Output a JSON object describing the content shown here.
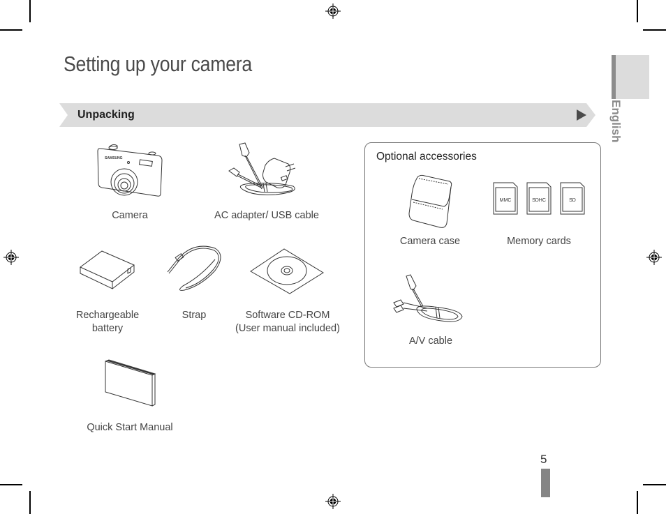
{
  "page": {
    "title": "Setting up your camera",
    "language_tab": "English",
    "page_number": "5"
  },
  "section": {
    "heading": "Unpacking"
  },
  "included_items": [
    {
      "label": "Camera",
      "icon": "camera-icon"
    },
    {
      "label": "AC adapter/ USB cable",
      "icon": "ac-adapter-icon"
    },
    {
      "label_line1": "Rechargeable",
      "label_line2": "battery",
      "icon": "battery-icon"
    },
    {
      "label": "Strap",
      "icon": "strap-icon"
    },
    {
      "label_line1": "Software CD-ROM",
      "label_line2": "(User manual included)",
      "icon": "cd-rom-icon"
    },
    {
      "label": "Quick Start Manual",
      "icon": "manual-icon"
    }
  ],
  "optional_accessories": {
    "title": "Optional accessories",
    "items": [
      {
        "label": "Camera case",
        "icon": "camera-case-icon"
      },
      {
        "label": "Memory cards",
        "icon": "memory-card-icon",
        "cards": [
          "MMC",
          "SDHC",
          "SD"
        ]
      },
      {
        "label": "A/V cable",
        "icon": "av-cable-icon"
      }
    ]
  },
  "colors": {
    "banner": "#dcdcdc",
    "tab_bar": "#8c8c8c",
    "page_bar": "#858585",
    "title_text": "#4a4a4a"
  }
}
